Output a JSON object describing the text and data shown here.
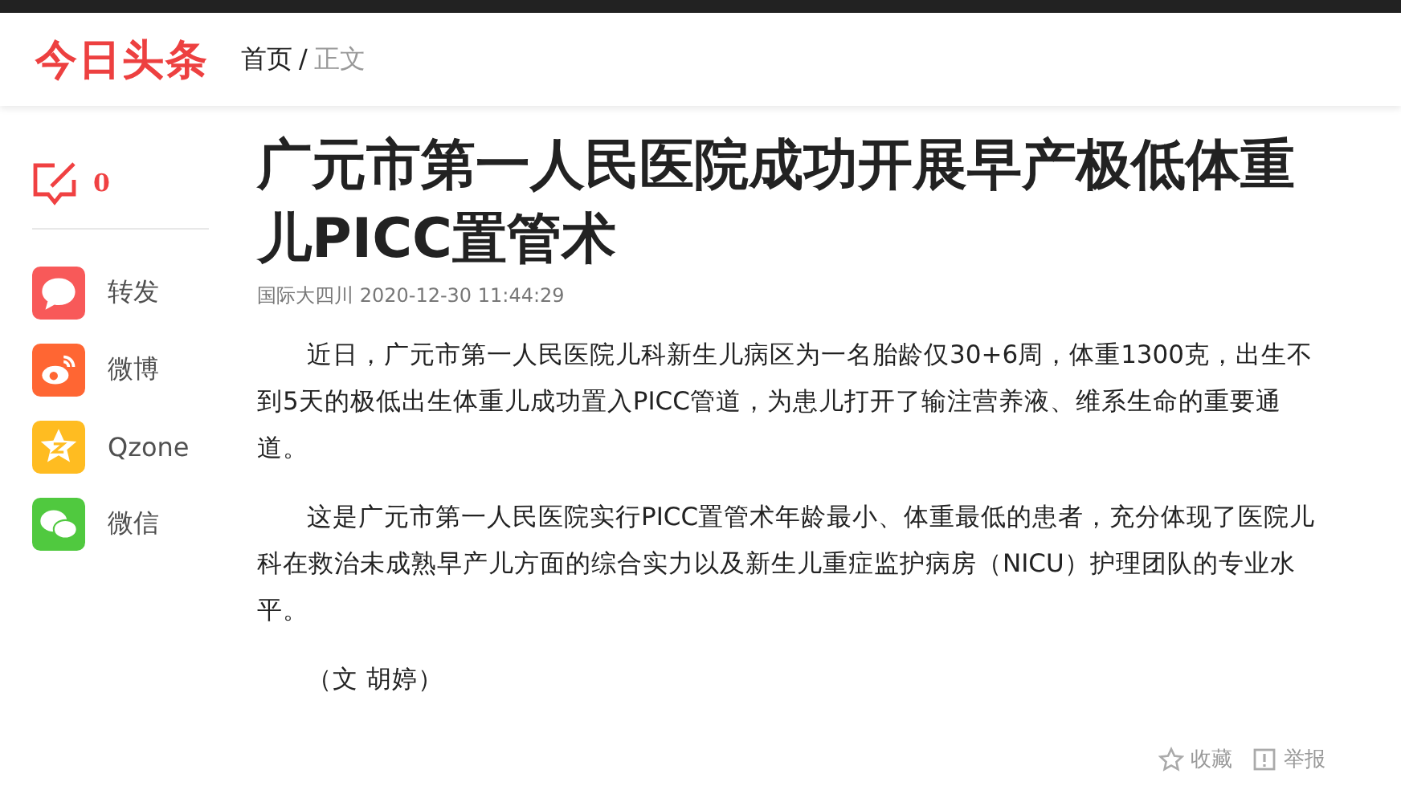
{
  "header": {
    "logo": "今日头条",
    "breadcrumb": {
      "separator": "/",
      "items": [
        {
          "label": "首页",
          "current": false
        },
        {
          "label": "正文",
          "current": true
        }
      ]
    }
  },
  "sidebar": {
    "comment_count": "0",
    "share": [
      {
        "kind": "repost",
        "label": "转发"
      },
      {
        "kind": "weibo",
        "label": "微博"
      },
      {
        "kind": "qzone",
        "label": "Qzone"
      },
      {
        "kind": "wechat",
        "label": "微信"
      }
    ]
  },
  "article": {
    "title": "广元市第一人民医院成功开展早产极低体重儿PICC置管术",
    "source": "国际大四川",
    "time": "2020-12-30 11:44:29",
    "paragraphs": [
      "近日，广元市第一人民医院儿科新生儿病区为一名胎龄仅30+6周，体重1300克，出生不到5天的极低出生体重儿成功置入PICC管道，为患儿打开了输注营养液、维系生命的重要通道。",
      "这是广元市第一人民医院实行PICC置管术年龄最小、体重最低的患者，充分体现了医院儿科在救治未成熟早产儿方面的综合实力以及新生儿重症监护病房（NICU）护理团队的专业水平。",
      "（文 胡婷）"
    ],
    "actions": [
      {
        "kind": "favorite",
        "label": "收藏"
      },
      {
        "kind": "report",
        "label": "举报"
      }
    ]
  }
}
